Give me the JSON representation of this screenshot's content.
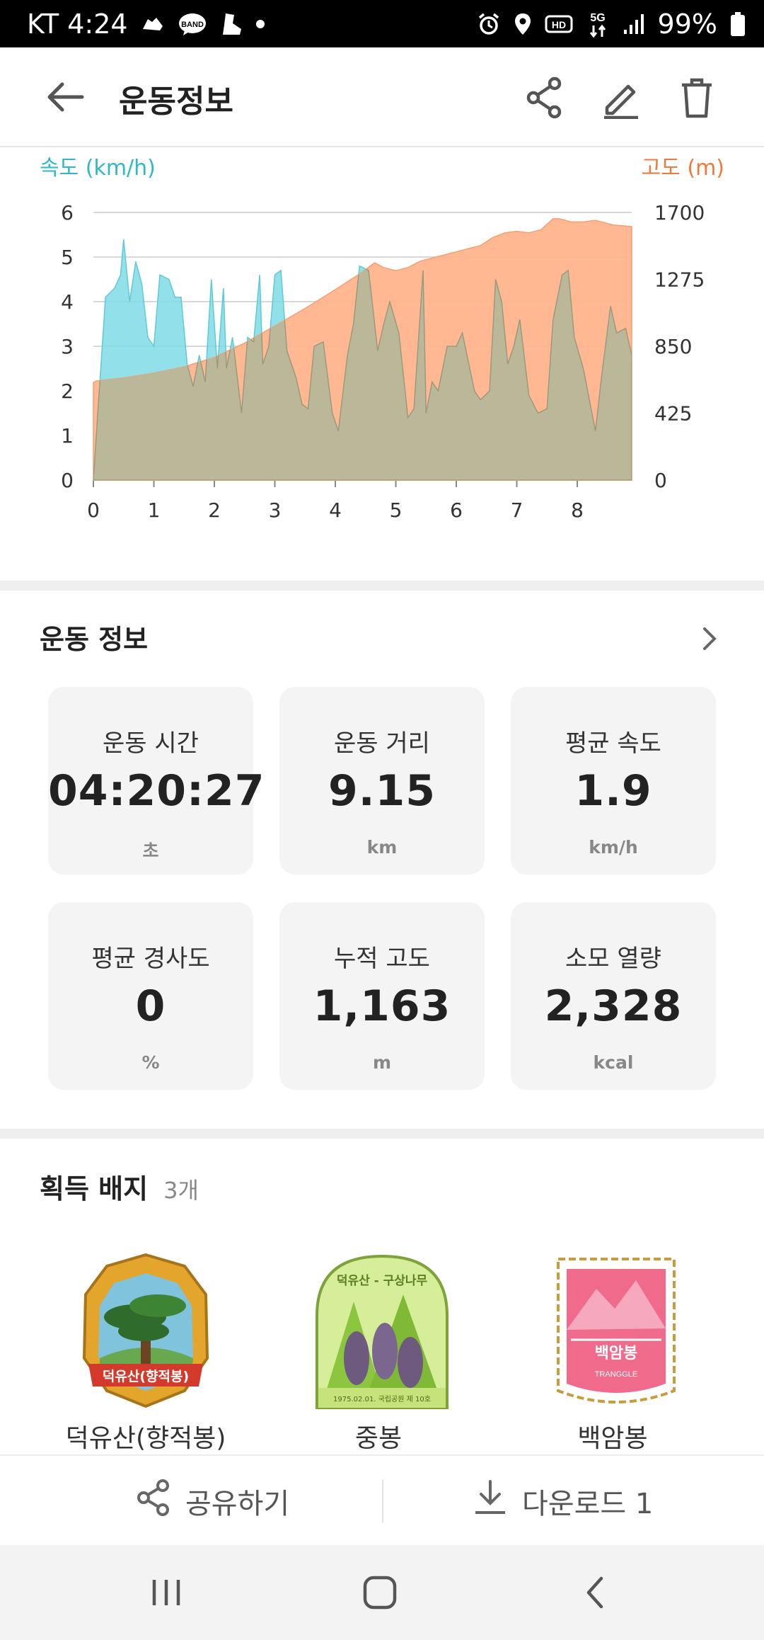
{
  "status_bar": {
    "carrier_time": "KT 4:24",
    "band_label": "BAND",
    "hd_label": "HD",
    "net_label": "5G",
    "battery": "99%"
  },
  "header": {
    "title": "운동정보",
    "back_icon": "back-arrow-icon",
    "actions": [
      "share-icon",
      "edit-icon",
      "delete-icon"
    ]
  },
  "chart_data": {
    "type": "area",
    "y_left_label": "속도 (km/h)",
    "y_right_label": "고도 (m)",
    "x_ticks": [
      "0",
      "1",
      "2",
      "3",
      "4",
      "5",
      "6",
      "7",
      "8"
    ],
    "y_left_ticks": [
      "0",
      "1",
      "2",
      "3",
      "4",
      "5",
      "6"
    ],
    "y_right_ticks": [
      "0",
      "425",
      "850",
      "1275",
      "1700"
    ],
    "xlim": [
      0,
      8.9
    ],
    "ylim_left": [
      0,
      6
    ],
    "ylim_right": [
      0,
      1700
    ],
    "colors": {
      "speed": "#7fdce6",
      "elevation": "#ffb48c",
      "overlap": "#bbb899"
    },
    "series": [
      {
        "axis": "left",
        "x": [
          0,
          0.2,
          0.35,
          0.45,
          0.5,
          0.6,
          0.7,
          0.8,
          0.9,
          1.0,
          1.1,
          1.25,
          1.35,
          1.45,
          1.55,
          1.65,
          1.75,
          1.85,
          1.95,
          2.05,
          2.15,
          2.2,
          2.3,
          2.45,
          2.55,
          2.65,
          2.75,
          2.8,
          2.9,
          3.0,
          3.1,
          3.2,
          3.35,
          3.45,
          3.55,
          3.65,
          3.8,
          3.95,
          4.05,
          4.2,
          4.3,
          4.4,
          4.55,
          4.7,
          4.8,
          4.9,
          5.05,
          5.2,
          5.3,
          5.45,
          5.5,
          5.6,
          5.7,
          5.85,
          6.0,
          6.1,
          6.3,
          6.4,
          6.55,
          6.65,
          6.75,
          6.85,
          6.95,
          7.05,
          7.2,
          7.35,
          7.5,
          7.6,
          7.75,
          7.85,
          7.95,
          8.1,
          8.3,
          8.4,
          8.55,
          8.65,
          8.8,
          8.9
        ],
        "values": [
          0,
          4.1,
          4.3,
          4.6,
          5.4,
          4.0,
          4.9,
          4.4,
          3.2,
          3.0,
          4.6,
          4.5,
          4.1,
          4.1,
          2.6,
          2.1,
          2.8,
          2.2,
          4.5,
          2.5,
          4.3,
          2.5,
          3.2,
          1.5,
          3.2,
          3.1,
          4.6,
          2.6,
          3.0,
          4.6,
          4.7,
          2.9,
          2.3,
          1.7,
          1.6,
          3.0,
          3.1,
          1.5,
          1.1,
          2.8,
          3.5,
          4.8,
          4.7,
          2.9,
          3.5,
          4.0,
          3.3,
          1.4,
          1.6,
          4.7,
          1.5,
          2.2,
          2.0,
          3.0,
          3.0,
          3.3,
          2.0,
          1.8,
          2.0,
          4.5,
          4.0,
          2.6,
          3.0,
          3.6,
          1.9,
          1.5,
          1.6,
          3.6,
          4.6,
          4.7,
          3.2,
          2.5,
          1.1,
          2.3,
          3.9,
          3.3,
          3.4,
          2.8
        ]
      },
      {
        "axis": "right",
        "x": [
          0,
          0.05,
          0.5,
          1.0,
          1.5,
          2.0,
          2.5,
          3.0,
          3.5,
          4.0,
          4.4,
          4.65,
          4.8,
          5.0,
          5.2,
          5.4,
          5.6,
          5.8,
          6.0,
          6.2,
          6.4,
          6.6,
          6.8,
          7.0,
          7.2,
          7.4,
          7.6,
          7.7,
          7.9,
          8.1,
          8.3,
          8.5,
          8.6,
          8.9
        ],
        "values": [
          620,
          630,
          650,
          680,
          720,
          780,
          870,
          980,
          1090,
          1210,
          1310,
          1380,
          1350,
          1330,
          1350,
          1390,
          1410,
          1430,
          1450,
          1470,
          1490,
          1540,
          1570,
          1580,
          1570,
          1590,
          1660,
          1660,
          1640,
          1640,
          1650,
          1630,
          1620,
          1610
        ]
      }
    ]
  },
  "stats_section": {
    "title": "운동 정보",
    "items": [
      {
        "label": "운동 시간",
        "value": "04:20:27",
        "unit": "초"
      },
      {
        "label": "운동 거리",
        "value": "9.15",
        "unit": "km"
      },
      {
        "label": "평균 속도",
        "value": "1.9",
        "unit": "km/h"
      },
      {
        "label": "평균 경사도",
        "value": "0",
        "unit": "%"
      },
      {
        "label": "누적 고도",
        "value": "1,163",
        "unit": "m"
      },
      {
        "label": "소모 열량",
        "value": "2,328",
        "unit": "kcal"
      }
    ]
  },
  "badges_section": {
    "title": "획득 배지",
    "count": "3개",
    "items": [
      {
        "name": "덕유산(향적봉)",
        "art_text": "덕유산(향적봉)",
        "icon": "pine-tree-badge-icon"
      },
      {
        "name": "중봉",
        "art_text": "덕유산 - 구상나무",
        "art_subtext": "1975.02.01. 국립공원 제 10호",
        "icon": "pine-cone-badge-icon"
      },
      {
        "name": "백암봉",
        "art_text": "백암봉",
        "art_subtext": "TRANGGLE",
        "icon": "mountain-badge-icon"
      }
    ]
  },
  "bottom_actions": {
    "share_label": "공유하기",
    "download_label": "다운로드 1"
  },
  "nav_bar": {
    "buttons": [
      "recent-apps-icon",
      "home-icon",
      "nav-back-icon"
    ]
  }
}
